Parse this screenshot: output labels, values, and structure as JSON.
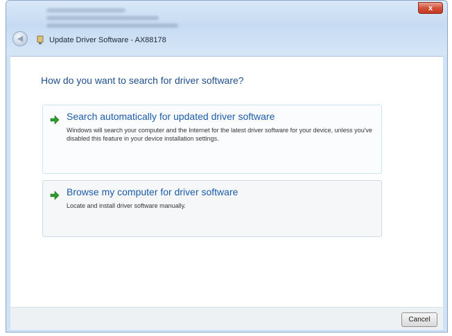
{
  "window": {
    "title": "Update Driver Software - AX88178",
    "close_label": "x"
  },
  "content": {
    "question": "How do you want to search for driver software?",
    "options": [
      {
        "title": "Search automatically for updated driver software",
        "description": "Windows will search your computer and the Internet for the latest driver software for your device, unless you've disabled this feature in your device installation settings.",
        "icon": "green-arrow-icon"
      },
      {
        "title": "Browse my computer for driver software",
        "description": "Locate and install driver software manually.",
        "icon": "green-arrow-icon"
      }
    ]
  },
  "footer": {
    "cancel_label": "Cancel"
  },
  "colors": {
    "accent_link": "#1a5ba8",
    "arrow_green": "#2e9b2e",
    "close_red": "#c2391f"
  }
}
